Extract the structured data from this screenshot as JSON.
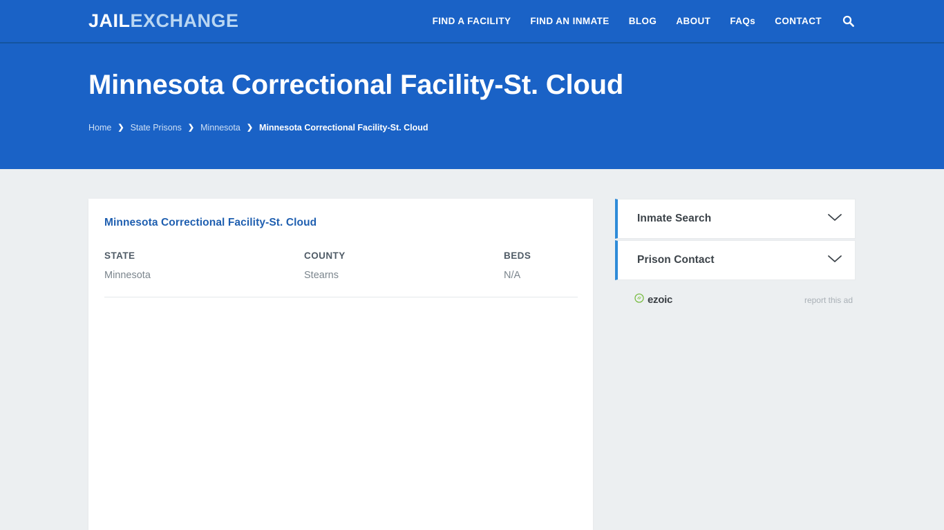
{
  "header": {
    "logo": {
      "part1": "JAIL",
      "part2": "EXCHANGE"
    },
    "nav": [
      {
        "label": "FIND A FACILITY"
      },
      {
        "label": "FIND AN INMATE"
      },
      {
        "label": "BLOG"
      },
      {
        "label": "ABOUT"
      },
      {
        "label": "FAQs"
      },
      {
        "label": "CONTACT"
      }
    ],
    "search_icon": "search-icon"
  },
  "hero": {
    "title": "Minnesota Correctional Facility-St. Cloud",
    "breadcrumb": [
      {
        "label": "Home"
      },
      {
        "label": "State Prisons"
      },
      {
        "label": "Minnesota"
      },
      {
        "label": "Minnesota Correctional Facility-St. Cloud"
      }
    ],
    "separator": "❯"
  },
  "main": {
    "card_title": "Minnesota Correctional Facility-St. Cloud",
    "facts": [
      {
        "label": "STATE",
        "value": "Minnesota"
      },
      {
        "label": "COUNTY",
        "value": "Stearns"
      },
      {
        "label": "BEDS",
        "value": "N/A"
      }
    ]
  },
  "sidebar": {
    "accordion": [
      {
        "title": "Inmate Search",
        "icon": "chevron-down-icon"
      },
      {
        "title": "Prison Contact",
        "icon": "chevron-down-icon"
      }
    ],
    "ad": {
      "brand": "ezoic",
      "report_label": "report this ad"
    }
  },
  "colors": {
    "brand_blue": "#1a62c6",
    "accent_blue": "#2f8bd8",
    "link_blue": "#1f5fb0",
    "page_background": "#eceff1",
    "ezoic_green": "#79bc43"
  }
}
